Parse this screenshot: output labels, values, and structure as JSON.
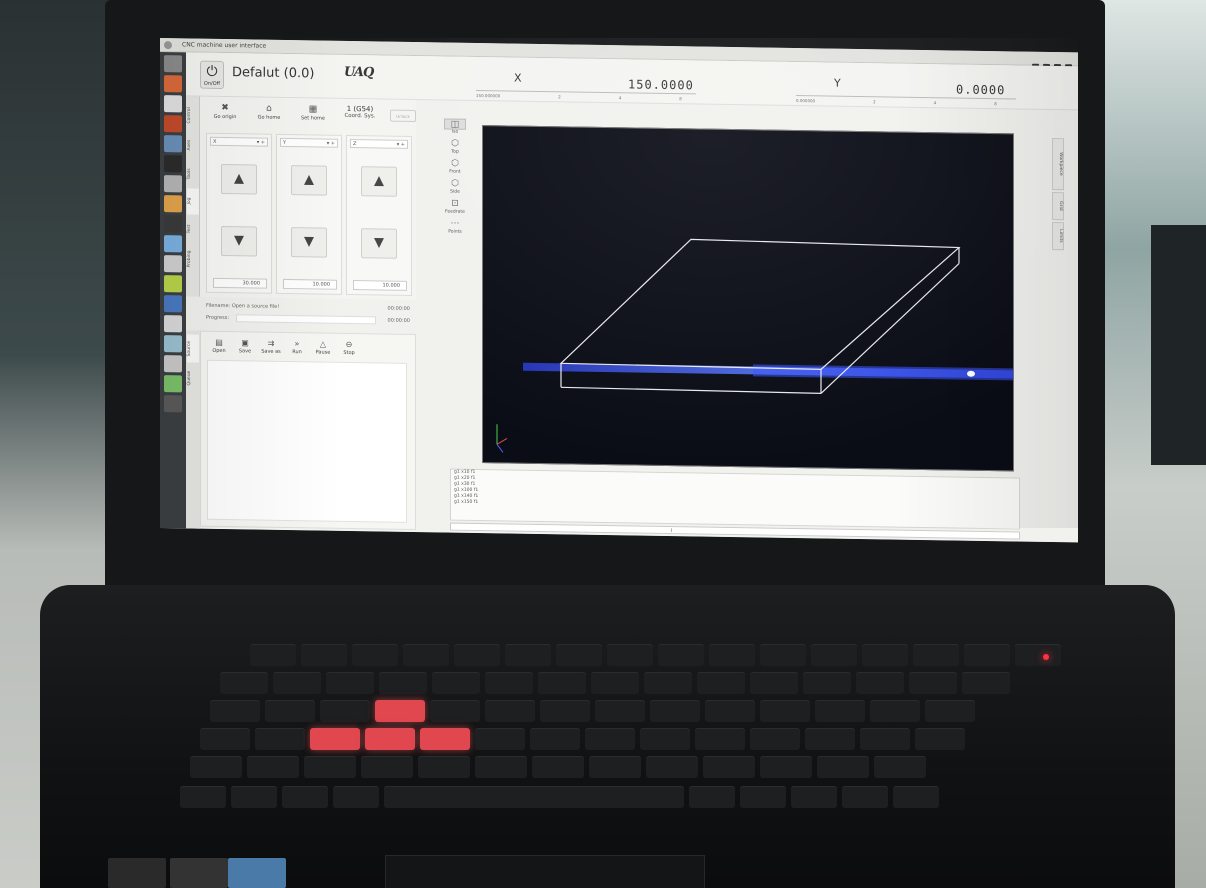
{
  "window": {
    "title": "CNC machine user interface",
    "status_indicators": [
      "wifi-icon",
      "battery-icon",
      "volume-icon",
      "clock-icon"
    ]
  },
  "header": {
    "power_label": "On/Off",
    "machine_name": "Defalut (0.0)",
    "logo_text": "UAQ",
    "axes": [
      {
        "label": "X",
        "value": "150.0000",
        "scale_min": "150.000000",
        "ticks": [
          "2",
          "4",
          "6",
          "8"
        ]
      },
      {
        "label": "Y",
        "value": "0.0000",
        "scale_min": "0.000000",
        "ticks": [
          "2",
          "4",
          "6",
          "8"
        ]
      }
    ]
  },
  "left_tabs": [
    "Control",
    "Axes",
    "Tools",
    "Jog",
    "Test",
    "Probing"
  ],
  "control": {
    "go_origin": "Go origin",
    "go_home": "Go home",
    "set_home": "Set home",
    "coord_system_value": "1 (G54)",
    "coord_system_label": "Coord. Sys.",
    "unlock_label": "Unlock"
  },
  "jog": {
    "columns": [
      {
        "axis": "X",
        "step": "30.000"
      },
      {
        "axis": "Y",
        "step": "10.000"
      },
      {
        "axis": "Z",
        "step": "10.000"
      }
    ]
  },
  "file": {
    "filename_label": "Filename: Open a source file!",
    "filename_right": "00:00:00",
    "progress_label": "Progress:",
    "progress_right": "00:00:00"
  },
  "file_tabs": [
    "Source",
    "Queue"
  ],
  "file_toolbar": [
    "Open",
    "Save",
    "Save as",
    "Run",
    "Pause",
    "Stop"
  ],
  "view_tools": [
    "Iso",
    "Top",
    "Front",
    "Side",
    "Feedrate",
    "Points"
  ],
  "right_tabs": [
    "Workpiece",
    "Grid",
    "Limits"
  ],
  "console_lines": [
    "g1 x10 f1",
    "g1 x20 f1",
    "g1 x30 f1",
    "g1 x100 f1",
    "g1 x140 f1",
    "g1 x150 f1"
  ],
  "colors": {
    "viewport_bg": "#0a0c16",
    "toolpath": "#3c5dff",
    "workpiece_outline": "#e8e8f0"
  }
}
